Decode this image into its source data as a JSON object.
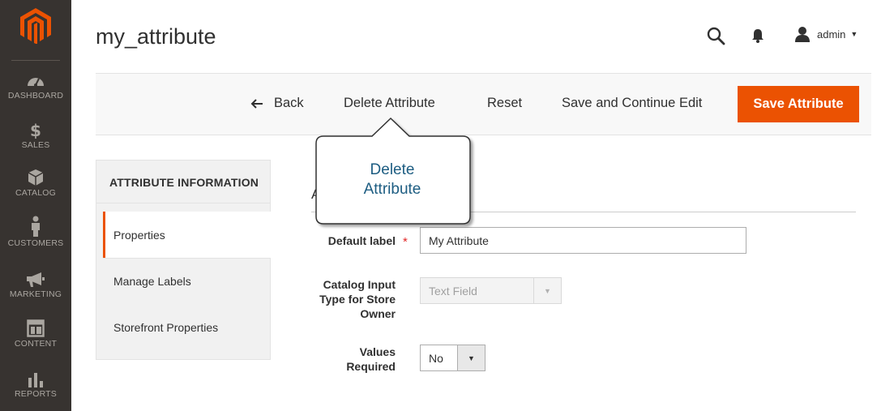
{
  "sidebar": {
    "items": [
      {
        "label": "DASHBOARD",
        "icon": "dashboard-icon"
      },
      {
        "label": "SALES",
        "icon": "dollar-icon"
      },
      {
        "label": "CATALOG",
        "icon": "box-icon"
      },
      {
        "label": "CUSTOMERS",
        "icon": "person-icon"
      },
      {
        "label": "MARKETING",
        "icon": "megaphone-icon"
      },
      {
        "label": "CONTENT",
        "icon": "layout-icon"
      },
      {
        "label": "REPORTS",
        "icon": "bar-chart-icon"
      }
    ]
  },
  "header": {
    "title": "my_attribute",
    "user": "admin"
  },
  "actions": {
    "back": "Back",
    "delete": "Delete Attribute",
    "reset": "Reset",
    "save_continue": "Save and Continue Edit",
    "save": "Save Attribute"
  },
  "tabs": {
    "title": "ATTRIBUTE INFORMATION",
    "items": [
      "Properties",
      "Manage Labels",
      "Storefront Properties"
    ]
  },
  "form": {
    "legend": "A",
    "default_label": {
      "label": "Default label",
      "required": "*",
      "value": "My Attribute"
    },
    "input_type": {
      "label_line1": "Catalog Input",
      "label_line2": "Type for Store",
      "label_line3": "Owner",
      "value": "Text Field"
    },
    "values_required": {
      "label_line1": "Values",
      "label_line2": "Required",
      "value": "No"
    }
  },
  "callout": {
    "line1": "Delete",
    "line2": "Attribute"
  },
  "colors": {
    "accent": "#eb5202",
    "sidebar_bg": "#373330",
    "callout_text": "#1d5d82"
  }
}
